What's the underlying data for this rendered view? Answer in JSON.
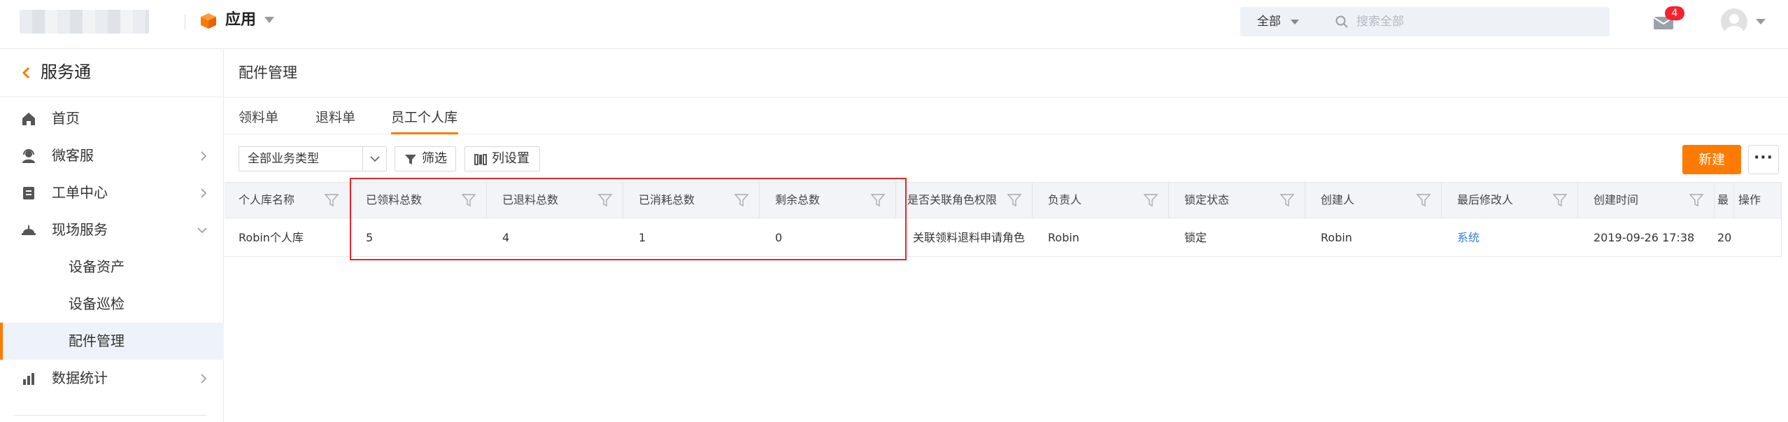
{
  "topbar": {
    "app_label": "应用",
    "search_scope": "全部",
    "search_placeholder": "搜索全部",
    "mail_badge": "4"
  },
  "sidebar": {
    "title": "服务通",
    "items": [
      {
        "label": "首页",
        "icon": "home-icon"
      },
      {
        "label": "微客服",
        "icon": "customer-service-icon"
      },
      {
        "label": "工单中心",
        "icon": "ticket-icon"
      },
      {
        "label": "现场服务",
        "icon": "helmet-icon"
      },
      {
        "label": "数据统计",
        "icon": "bar-chart-icon"
      }
    ],
    "subitems": [
      {
        "label": "设备资产"
      },
      {
        "label": "设备巡检"
      },
      {
        "label": "配件管理"
      }
    ]
  },
  "main": {
    "page_title": "配件管理",
    "tabs": [
      {
        "label": "领料单"
      },
      {
        "label": "退料单"
      },
      {
        "label": "员工个人库"
      }
    ],
    "toolbar": {
      "business_type": "全部业务类型",
      "filter_label": "筛选",
      "columns_label": "列设置",
      "new_label": "新建",
      "more_label": "···"
    },
    "table": {
      "columns": [
        "个人库名称",
        "已领料总数",
        "已退料总数",
        "已消耗总数",
        "剩余总数",
        "是否关联角色权限",
        "负责人",
        "锁定状态",
        "创建人",
        "最后修改人",
        "创建时间",
        "最",
        "操作"
      ],
      "rows": [
        [
          "Robin个人库",
          "5",
          "4",
          "1",
          "0",
          "关联领料退料申请角色",
          "Robin",
          "锁定",
          "Robin",
          "系统",
          "2019-09-26 17:38",
          "20",
          ""
        ]
      ]
    }
  },
  "colors": {
    "accent": "#ff7a00",
    "badge": "#f5222d",
    "link": "#2f7fe0",
    "highlight": "#e5262b"
  }
}
